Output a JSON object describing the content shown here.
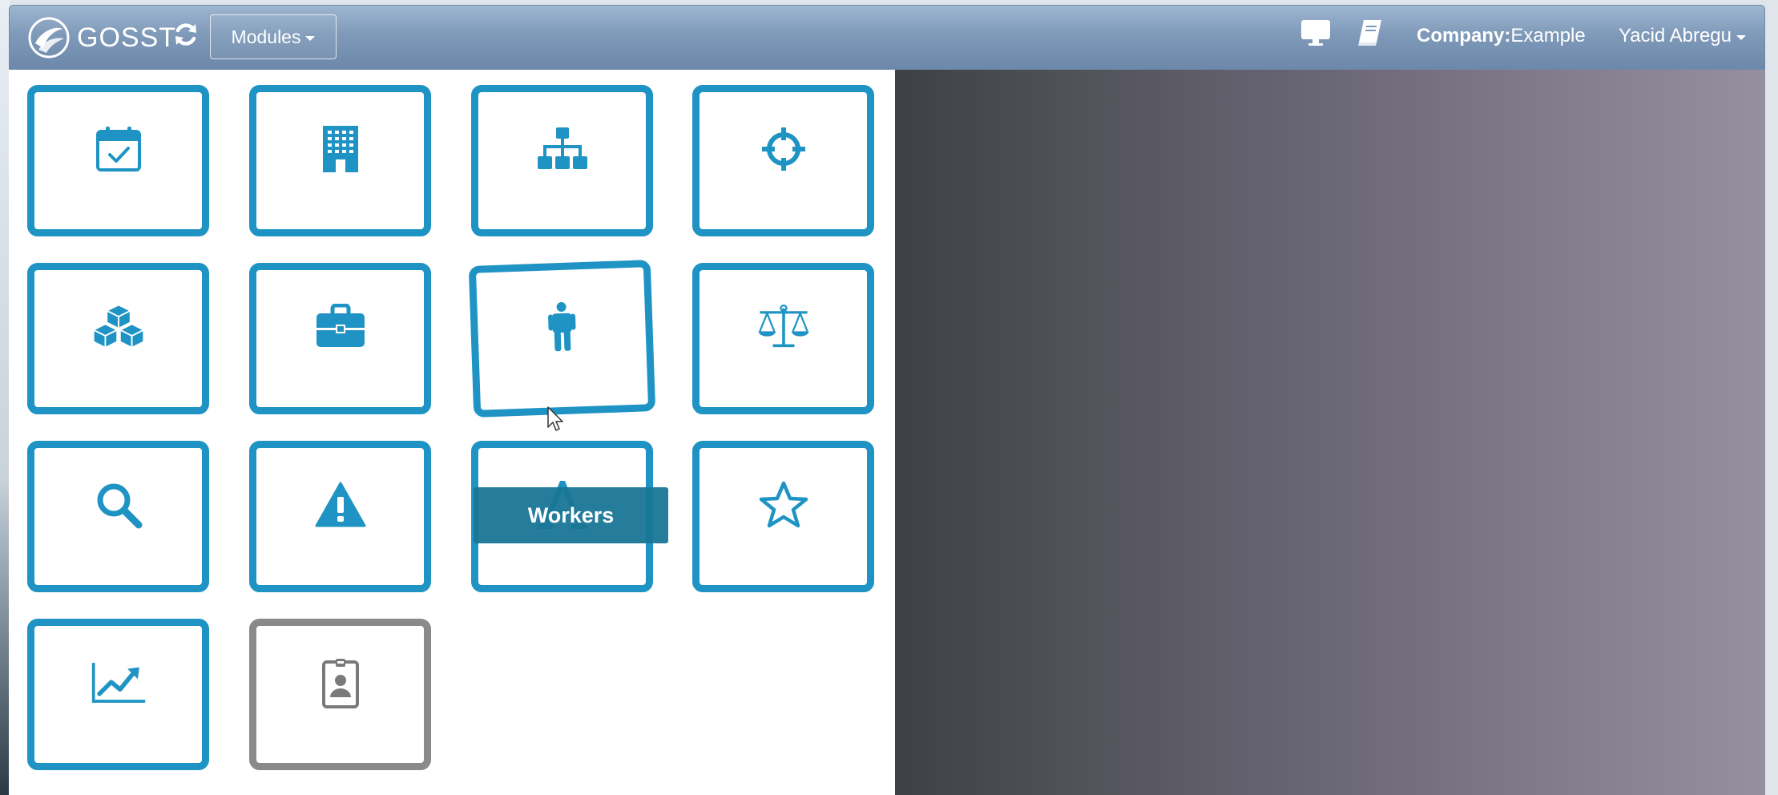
{
  "navbar": {
    "brand": "GOSST",
    "modules_label": "Modules",
    "company_label": "Company:",
    "company_value": "Example",
    "user_name": "Yacid Abregu"
  },
  "tooltip": {
    "text": "Workers"
  },
  "tiles": [
    {
      "icon": "calendar-check-icon"
    },
    {
      "icon": "building-icon"
    },
    {
      "icon": "org-chart-icon"
    },
    {
      "icon": "crosshairs-icon"
    },
    {
      "icon": "cubes-icon"
    },
    {
      "icon": "briefcase-icon"
    },
    {
      "icon": "male-person-icon"
    },
    {
      "icon": "balance-scale-icon"
    },
    {
      "icon": "search-icon"
    },
    {
      "icon": "warning-icon"
    },
    {
      "icon": "font-letter-a-icon"
    },
    {
      "icon": "star-icon"
    },
    {
      "icon": "line-chart-icon"
    },
    {
      "icon": "id-badge-icon",
      "disabled": true
    }
  ],
  "colors": {
    "tile_border": "#1f94c4",
    "tile_disabled_border": "#8a8a8a",
    "navbar_top": "#9fb6d1",
    "navbar_bottom": "#6c88aa",
    "tooltip_bg": "#197696"
  }
}
